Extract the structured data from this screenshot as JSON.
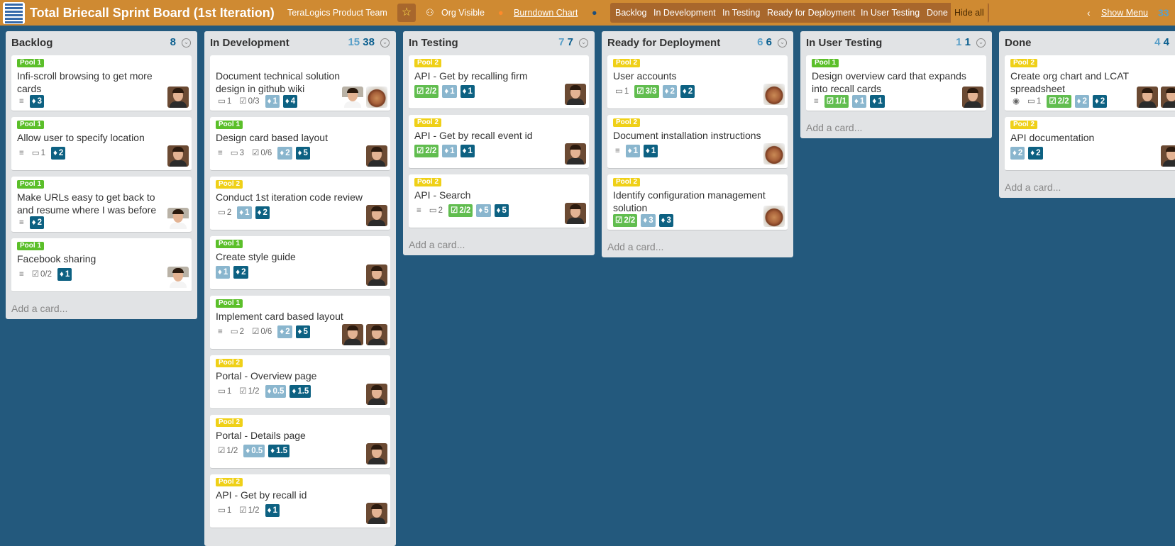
{
  "header": {
    "board_title": "Total Briecall Sprint Board (1st Iteration)",
    "team": "TeraLogics Product Team",
    "visibility": "Org Visible",
    "burndown": "Burndown Chart",
    "filters": [
      "Backlog",
      "In Development",
      "In Testing",
      "Ready for Deployment",
      "In User Testing",
      "Done"
    ],
    "hide_all": "Hide all",
    "show_menu": "Show Menu",
    "right_counts": "33"
  },
  "lists": [
    {
      "title": "Backlog",
      "count_a": "",
      "count_b": "8",
      "add": "Add a card...",
      "cards": [
        {
          "pool": "Pool 1",
          "title": "Infi-scroll browsing to get more cards",
          "badges": [
            {
              "t": "desc"
            },
            {
              "t": "est2",
              "v": "3"
            }
          ],
          "avatars": [
            "face"
          ]
        },
        {
          "pool": "Pool 1",
          "title": "Allow user to specify location",
          "badges": [
            {
              "t": "desc"
            },
            {
              "t": "comment",
              "v": "1"
            },
            {
              "t": "est2",
              "v": "2"
            }
          ],
          "avatars": [
            "face"
          ]
        },
        {
          "pool": "Pool 1",
          "title": "Make URLs easy to get back to and resume where I was before",
          "badges": [
            {
              "t": "desc"
            },
            {
              "t": "est2",
              "v": "2"
            }
          ],
          "avatars": [
            "doc"
          ]
        },
        {
          "pool": "Pool 1",
          "title": "Facebook sharing",
          "badges": [
            {
              "t": "desc"
            },
            {
              "t": "check",
              "v": "0/2"
            },
            {
              "t": "est2",
              "v": "1"
            }
          ],
          "avatars": [
            "doc"
          ]
        }
      ]
    },
    {
      "title": "In Development",
      "count_a": "15",
      "count_b": "38",
      "add": "",
      "cards": [
        {
          "pool": "",
          "title": "Document technical solution design in github wiki",
          "badges": [
            {
              "t": "comment",
              "v": "1"
            },
            {
              "t": "check",
              "v": "0/3"
            },
            {
              "t": "est1",
              "v": "1"
            },
            {
              "t": "est2",
              "v": "4"
            }
          ],
          "avatars": [
            "doc",
            "coffee"
          ]
        },
        {
          "pool": "Pool 1",
          "title": "Design card based layout",
          "badges": [
            {
              "t": "desc"
            },
            {
              "t": "comment",
              "v": "3"
            },
            {
              "t": "check",
              "v": "0/6"
            },
            {
              "t": "est1",
              "v": "2"
            },
            {
              "t": "est2",
              "v": "5"
            }
          ],
          "avatars": [
            "face"
          ]
        },
        {
          "pool": "Pool 2",
          "title": "Conduct 1st iteration code review",
          "badges": [
            {
              "t": "comment",
              "v": "2"
            },
            {
              "t": "est1",
              "v": "1"
            },
            {
              "t": "est2",
              "v": "2"
            }
          ],
          "avatars": [
            "face"
          ]
        },
        {
          "pool": "Pool 1",
          "title": "Create style guide",
          "badges": [
            {
              "t": "est1",
              "v": "1"
            },
            {
              "t": "est2",
              "v": "2"
            }
          ],
          "avatars": [
            "face"
          ]
        },
        {
          "pool": "Pool 1",
          "title": "Implement card based layout",
          "badges": [
            {
              "t": "desc"
            },
            {
              "t": "comment",
              "v": "2"
            },
            {
              "t": "check",
              "v": "0/6"
            },
            {
              "t": "est1",
              "v": "2"
            },
            {
              "t": "est2",
              "v": "5"
            }
          ],
          "avatars": [
            "face",
            "face"
          ]
        },
        {
          "pool": "Pool 2",
          "title": "Portal - Overview page",
          "badges": [
            {
              "t": "comment",
              "v": "1"
            },
            {
              "t": "check",
              "v": "1/2"
            },
            {
              "t": "est1",
              "v": "0.5"
            },
            {
              "t": "est2",
              "v": "1.5"
            }
          ],
          "avatars": [
            "face"
          ]
        },
        {
          "pool": "Pool 2",
          "title": "Portal - Details page",
          "badges": [
            {
              "t": "check",
              "v": "1/2"
            },
            {
              "t": "est1",
              "v": "0.5"
            },
            {
              "t": "est2",
              "v": "1.5"
            }
          ],
          "avatars": [
            "face"
          ]
        },
        {
          "pool": "Pool 2",
          "title": "API - Get by recall id",
          "badges": [
            {
              "t": "comment",
              "v": "1"
            },
            {
              "t": "check",
              "v": "1/2"
            },
            {
              "t": "est2",
              "v": "1"
            }
          ],
          "avatars": [
            "face"
          ]
        }
      ]
    },
    {
      "title": "In Testing",
      "count_a": "7",
      "count_b": "7",
      "add": "Add a card...",
      "cards": [
        {
          "pool": "Pool 2",
          "title": "API - Get by recalling firm",
          "badges": [
            {
              "t": "chk-ok",
              "v": "2/2"
            },
            {
              "t": "est1",
              "v": "1"
            },
            {
              "t": "est2",
              "v": "1"
            }
          ],
          "avatars": [
            "face"
          ]
        },
        {
          "pool": "Pool 2",
          "title": "API - Get by recall event id",
          "badges": [
            {
              "t": "chk-ok",
              "v": "2/2"
            },
            {
              "t": "est1",
              "v": "1"
            },
            {
              "t": "est2",
              "v": "1"
            }
          ],
          "avatars": [
            "face"
          ]
        },
        {
          "pool": "Pool 2",
          "title": "API - Search",
          "badges": [
            {
              "t": "desc"
            },
            {
              "t": "comment",
              "v": "2"
            },
            {
              "t": "chk-ok",
              "v": "2/2"
            },
            {
              "t": "est1",
              "v": "5"
            },
            {
              "t": "est2",
              "v": "5"
            }
          ],
          "avatars": [
            "face"
          ]
        }
      ]
    },
    {
      "title": "Ready for Deployment",
      "count_a": "6",
      "count_b": "6",
      "add": "Add a card...",
      "cards": [
        {
          "pool": "Pool 2",
          "title": "User accounts",
          "badges": [
            {
              "t": "comment",
              "v": "1"
            },
            {
              "t": "chk-ok",
              "v": "3/3"
            },
            {
              "t": "est1",
              "v": "2"
            },
            {
              "t": "est2",
              "v": "2"
            }
          ],
          "avatars": [
            "coffee"
          ]
        },
        {
          "pool": "Pool 2",
          "title": "Document installation instructions",
          "badges": [
            {
              "t": "desc"
            },
            {
              "t": "est1",
              "v": "1"
            },
            {
              "t": "est2",
              "v": "1"
            }
          ],
          "avatars": [
            "coffee"
          ]
        },
        {
          "pool": "Pool 2",
          "title": "Identify configuration management solution",
          "badges": [
            {
              "t": "chk-ok",
              "v": "2/2"
            },
            {
              "t": "est1",
              "v": "3"
            },
            {
              "t": "est2",
              "v": "3"
            }
          ],
          "avatars": [
            "coffee"
          ]
        }
      ]
    },
    {
      "title": "In User Testing",
      "count_a": "1",
      "count_b": "1",
      "add": "Add a card...",
      "cards": [
        {
          "pool": "Pool 1",
          "title": "Design overview card that expands into recall cards",
          "badges": [
            {
              "t": "desc"
            },
            {
              "t": "chk-ok",
              "v": "1/1"
            },
            {
              "t": "est1",
              "v": "1"
            },
            {
              "t": "est2",
              "v": "1"
            }
          ],
          "avatars": [
            "face"
          ]
        }
      ]
    },
    {
      "title": "Done",
      "count_a": "4",
      "count_b": "4",
      "add": "Add a card...",
      "cards": [
        {
          "pool": "Pool 2",
          "title": "Create org chart and LCAT spreadsheet",
          "badges": [
            {
              "t": "watch"
            },
            {
              "t": "comment",
              "v": "1"
            },
            {
              "t": "chk-ok",
              "v": "2/2"
            },
            {
              "t": "est1",
              "v": "2"
            },
            {
              "t": "est2",
              "v": "2"
            }
          ],
          "avatars": [
            "face",
            "face"
          ]
        },
        {
          "pool": "Pool 2",
          "title": "API documentation",
          "badges": [
            {
              "t": "est1",
              "v": "2"
            },
            {
              "t": "est2",
              "v": "2"
            }
          ],
          "avatars": [
            "face"
          ]
        }
      ]
    }
  ]
}
